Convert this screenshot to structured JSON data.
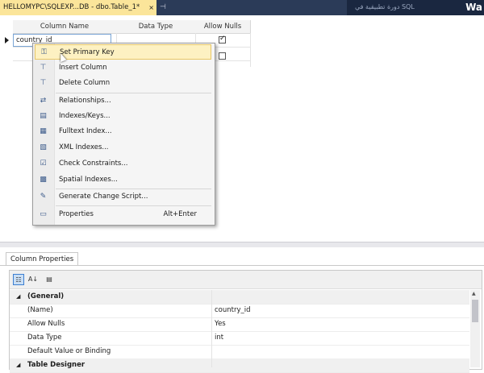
{
  "tab": {
    "title": "HELLOMYPC\\SQLEXP...DB - dbo.Table_1*",
    "close_glyph": "×",
    "pin_glyph": "⊣"
  },
  "banner": {
    "text": "دورة تطبيقية في SQL",
    "logo": "Wa"
  },
  "grid": {
    "headers": [
      "Column Name",
      "Data Type",
      "Allow Nulls"
    ],
    "rows": [
      {
        "name": "country_id",
        "type": "",
        "allow_nulls": true
      },
      {
        "name": "",
        "type": "",
        "allow_nulls": false
      }
    ]
  },
  "context_menu": {
    "items": [
      {
        "icon": "key-icon",
        "glyph": "⚿",
        "label": "Set Primary Key",
        "shortcut": "",
        "highlighted": true
      },
      {
        "icon": "insert-column-icon",
        "glyph": "⊤",
        "label": "Insert Column",
        "shortcut": ""
      },
      {
        "icon": "delete-column-icon",
        "glyph": "⊤",
        "label": "Delete Column",
        "shortcut": ""
      },
      {
        "icon": "relationships-icon",
        "glyph": "⇄",
        "label": "Relationships...",
        "shortcut": ""
      },
      {
        "icon": "indexes-icon",
        "glyph": "▤",
        "label": "Indexes/Keys...",
        "shortcut": ""
      },
      {
        "icon": "fulltext-index-icon",
        "glyph": "▦",
        "label": "Fulltext Index...",
        "shortcut": ""
      },
      {
        "icon": "xml-index-icon",
        "glyph": "▧",
        "label": "XML Indexes...",
        "shortcut": ""
      },
      {
        "icon": "check-constraints-icon",
        "glyph": "☑",
        "label": "Check Constraints...",
        "shortcut": ""
      },
      {
        "icon": "spatial-index-icon",
        "glyph": "▩",
        "label": "Spatial Indexes...",
        "shortcut": ""
      },
      {
        "icon": "script-icon",
        "glyph": "✎",
        "label": "Generate Change Script...",
        "shortcut": ""
      },
      {
        "icon": "properties-icon",
        "glyph": "▭",
        "label": "Properties",
        "shortcut": "Alt+Enter"
      }
    ]
  },
  "properties": {
    "tab_label": "Column Properties",
    "toolbar": [
      {
        "icon": "categorized-icon",
        "glyph": "☷"
      },
      {
        "icon": "alphabetical-icon",
        "glyph": "A↓"
      },
      {
        "icon": "property-pages-icon",
        "glyph": "▤"
      }
    ],
    "rows": [
      {
        "kind": "cat",
        "name": "(General)",
        "value": "",
        "expander": "◢"
      },
      {
        "kind": "prop",
        "name": "(Name)",
        "value": "country_id"
      },
      {
        "kind": "prop",
        "name": "Allow Nulls",
        "value": "Yes"
      },
      {
        "kind": "prop",
        "name": "Data Type",
        "value": "int"
      },
      {
        "kind": "prop",
        "name": "Default Value or Binding",
        "value": ""
      },
      {
        "kind": "cat",
        "name": "Table Designer",
        "value": "",
        "expander": "◢"
      }
    ]
  },
  "colors": {
    "tab_active": "#fbe59a",
    "titlebar": "#2b3b58",
    "menu_highlight": "#fdf1c2"
  }
}
